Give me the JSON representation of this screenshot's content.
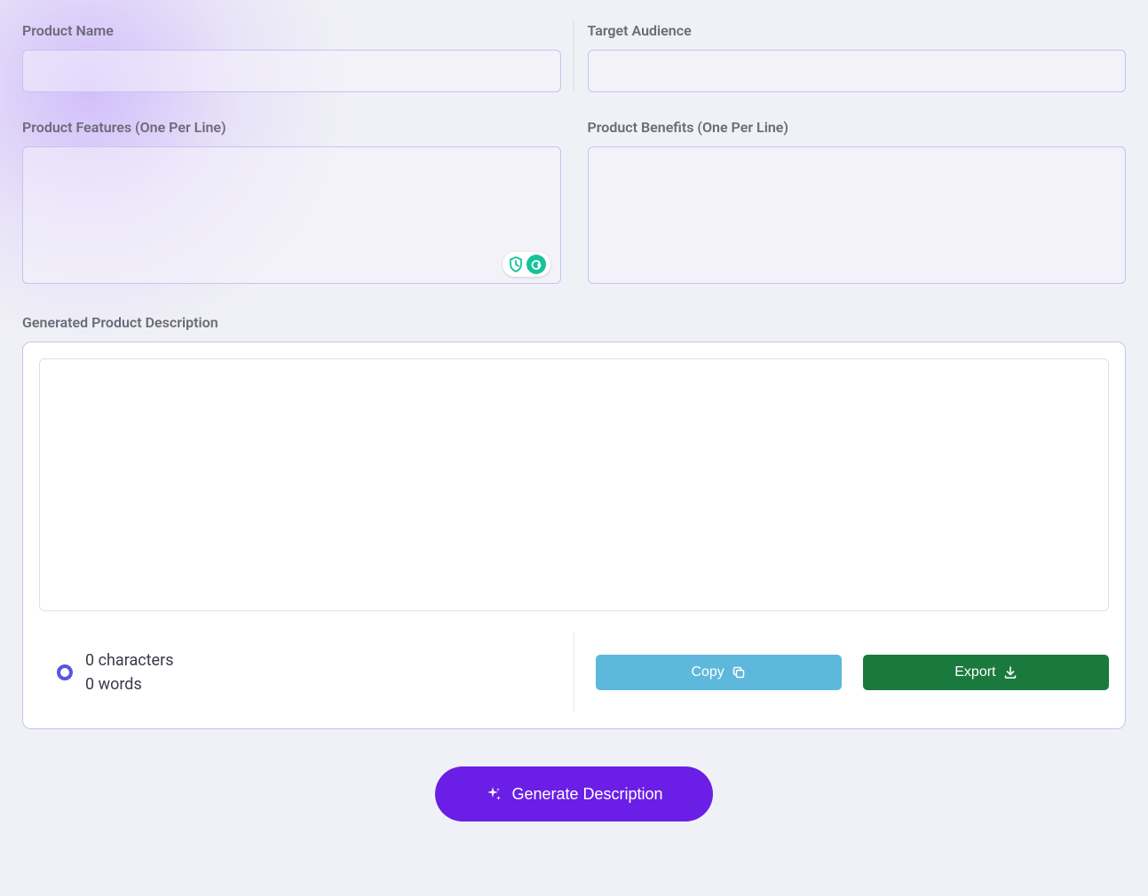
{
  "form": {
    "productName": {
      "label": "Product Name",
      "value": ""
    },
    "targetAudience": {
      "label": "Target Audience",
      "value": ""
    },
    "productFeatures": {
      "label": "Product Features (One Per Line)",
      "value": ""
    },
    "productBenefits": {
      "label": "Product Benefits (One Per Line)",
      "value": ""
    }
  },
  "output": {
    "label": "Generated Product Description",
    "value": "",
    "stats": {
      "characters": "0 characters",
      "words": "0 words"
    }
  },
  "buttons": {
    "copy": "Copy",
    "export": "Export",
    "generate": "Generate Description"
  }
}
